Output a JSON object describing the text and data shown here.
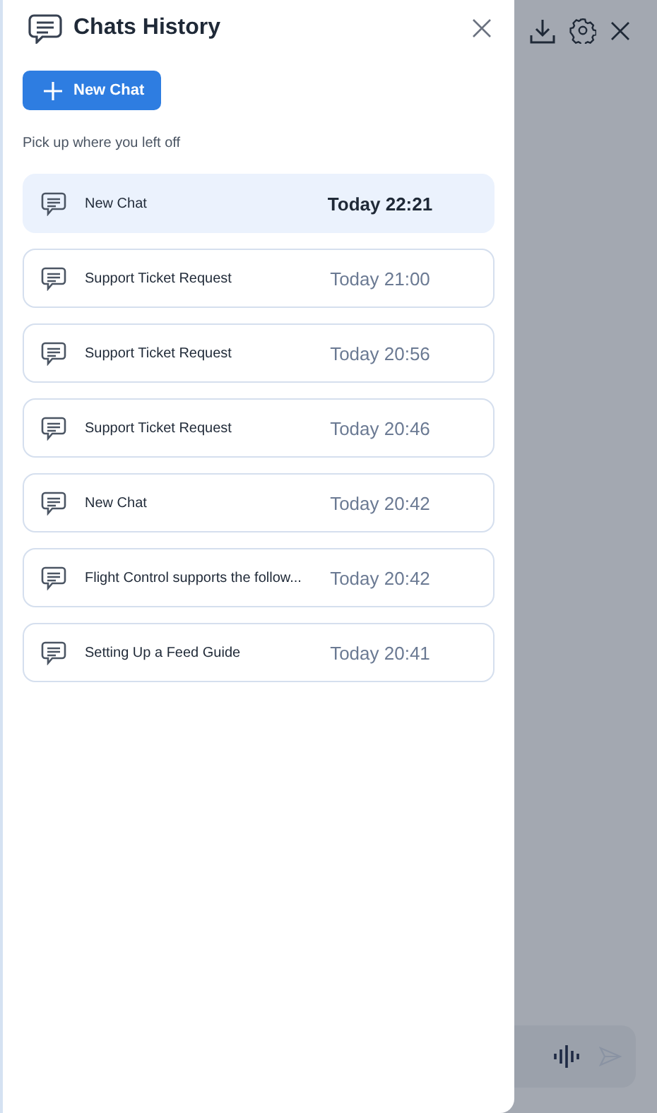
{
  "panel": {
    "title": "Chats History",
    "new_chat_button": "New Chat",
    "subtitle": "Pick up where you left off"
  },
  "chats": [
    {
      "title": "New Chat",
      "time": "Today 22:21",
      "selected": true
    },
    {
      "title": "Support Ticket Request",
      "time": "Today 21:00",
      "selected": false
    },
    {
      "title": "Support Ticket Request",
      "time": "Today 20:56",
      "selected": false
    },
    {
      "title": "Support Ticket Request",
      "time": "Today 20:46",
      "selected": false
    },
    {
      "title": "New Chat",
      "time": "Today 20:42",
      "selected": false
    },
    {
      "title": "Flight Control supports the follow...",
      "time": "Today 20:42",
      "selected": false
    },
    {
      "title": "Setting Up a Feed Guide",
      "time": "Today 20:41",
      "selected": false
    }
  ]
}
